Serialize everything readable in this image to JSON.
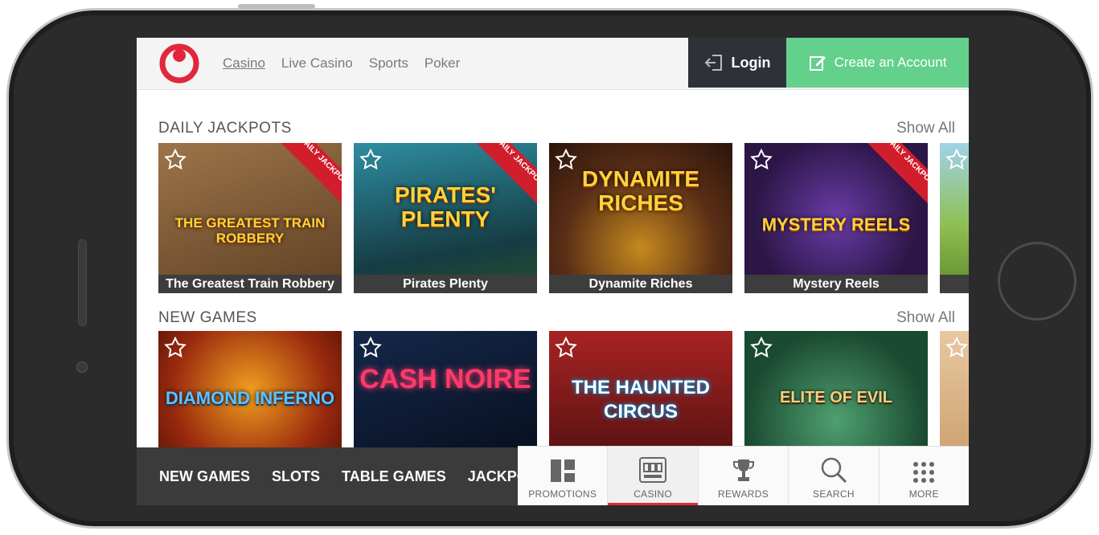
{
  "header": {
    "nav": [
      "Casino",
      "Live Casino",
      "Sports",
      "Poker"
    ],
    "login_label": "Login",
    "create_account_label": "Create an Account"
  },
  "daily_jackpots": {
    "title": "DAILY JACKPOTS",
    "show_all": "Show All",
    "ribbon": "DAILY JACKPOT",
    "games": [
      {
        "name": "The Greatest Train Robbery",
        "art_title": "THE GREATEST TRAIN ROBBERY",
        "color": "#7a5a36"
      },
      {
        "name": "Pirates Plenty",
        "art_title": "PIRATES' PLENTY",
        "color": "#1f5f6e"
      },
      {
        "name": "Dynamite Riches",
        "art_title": "DYNAMITE RICHES",
        "color": "#5a2e16"
      },
      {
        "name": "Mystery Reels",
        "art_title": "MYSTERY REELS",
        "color": "#3a1f5a"
      }
    ]
  },
  "new_games": {
    "title": "NEW GAMES",
    "show_all": "Show All",
    "games": [
      {
        "art_title": "DIAMOND INFERNO",
        "color": "#9a2a0e"
      },
      {
        "art_title": "CASH NOIRE",
        "color": "#0d1a33"
      },
      {
        "art_title": "THE HAUNTED CIRCUS",
        "color": "#6a1515"
      },
      {
        "art_title": "ELITE OF EVIL",
        "color": "#1f5a3a"
      }
    ]
  },
  "category_bar": [
    "NEW GAMES",
    "SLOTS",
    "TABLE GAMES",
    "JACKPOTS"
  ],
  "tabs": [
    {
      "label": "PROMOTIONS",
      "icon": "promotions-icon"
    },
    {
      "label": "CASINO",
      "icon": "slot-machine-icon"
    },
    {
      "label": "REWARDS",
      "icon": "trophy-icon"
    },
    {
      "label": "SEARCH",
      "icon": "search-icon"
    },
    {
      "label": "MORE",
      "icon": "grid-icon"
    }
  ],
  "colors": {
    "brand_red": "#e2273a",
    "create_green": "#63d08c",
    "login_dark": "#2e3238"
  }
}
